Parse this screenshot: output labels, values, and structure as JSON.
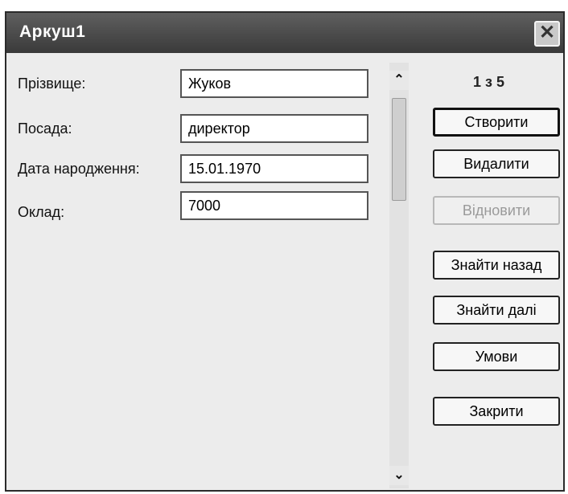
{
  "window": {
    "title": "Аркуш1",
    "close_label": "✕"
  },
  "form": {
    "fields": [
      {
        "label": "Прізвище:",
        "value": "Жуков"
      },
      {
        "label": "Посада:",
        "value": "директор"
      },
      {
        "label": "Дата народження:",
        "value": "15.01.1970"
      },
      {
        "label": "Оклад:",
        "value": "7000"
      }
    ],
    "record_counter": "1 з 5"
  },
  "scrollbar": {
    "up_arrow": "⌃",
    "down_arrow": "⌄"
  },
  "buttons": {
    "create": "Створити",
    "delete": "Видалити",
    "restore": "Відновити",
    "find_prev": "Знайти назад",
    "find_next": "Знайти далі",
    "criteria": "Умови",
    "close": "Закрити"
  }
}
